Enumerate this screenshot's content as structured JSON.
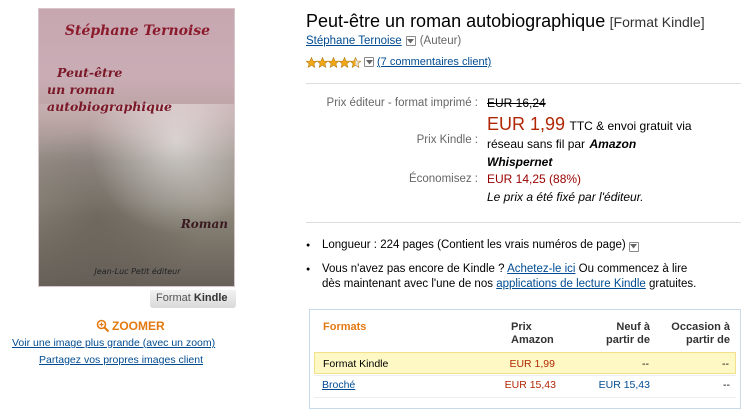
{
  "cover": {
    "author": "Stéphane Ternoise",
    "title_line1": "Peut-être",
    "title_line2": "un roman autobiographique",
    "genre": "Roman",
    "publisher": "Jean-Luc Petit éditeur",
    "format_tag_prefix": "Format",
    "format_tag_name": "Kindle"
  },
  "image_links": {
    "zoom_label": "ZOOMER",
    "larger_image": "Voir une image plus grande (avec un zoom)",
    "share_images": "Partagez vos propres images client"
  },
  "product": {
    "title": "Peut-être un roman autobiographique",
    "format": "[Format Kindle]",
    "author": "Stéphane Ternoise",
    "author_role": "(Auteur)",
    "rating": 4.5,
    "rating_max": 5,
    "reviews_link": "(7 commentaires client)"
  },
  "pricing": {
    "list_label": "Prix éditeur - format imprimé :",
    "list_price": "EUR 16,24",
    "kindle_label": "Prix Kindle :",
    "kindle_price": "EUR 1,99",
    "kindle_note_1": "TTC & envoi gratuit via",
    "kindle_note_2": "réseau sans fil par",
    "kindle_note_amazon": "Amazon",
    "kindle_note_whispernet": "Whispernet",
    "savings_label": "Économisez :",
    "savings_value": "EUR 14,25 (88%)",
    "publisher_note": "Le prix a été fixé par l'éditeur."
  },
  "details": {
    "length_label": "Longueur :",
    "length_value": "224 pages",
    "length_note": "(Contient les vrais numéros de page)",
    "kindle_text_1": "Vous n'avez pas encore de Kindle ?",
    "kindle_buy_link": "Achetez-le ici",
    "kindle_text_2": "Ou commencez à lire",
    "kindle_text_3": "dès maintenant avec l'une de nos",
    "kindle_apps_link": "applications de lecture Kindle",
    "kindle_text_4": "gratuites."
  },
  "formats_table": {
    "headers": {
      "formats": "Formats",
      "price_1": "Prix",
      "price_2": "Amazon",
      "new_1": "Neuf à",
      "new_2": "partir de",
      "used_1": "Occasion à",
      "used_2": "partir de"
    },
    "rows": [
      {
        "format": "Format Kindle",
        "price": "EUR 1,99",
        "new": "--",
        "used": "--",
        "selected": true
      },
      {
        "format": "Broché",
        "price": "EUR 15,43",
        "new": "EUR 15,43",
        "used": "--",
        "selected": false
      }
    ]
  },
  "colors": {
    "link": "#004b91",
    "price_red": "#b12704",
    "accent_orange": "#e47911",
    "selected_row_bg": "#fef9c4",
    "star_gold": "#f0a81a"
  }
}
